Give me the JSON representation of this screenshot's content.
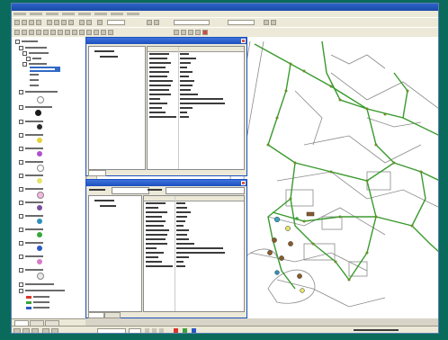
{
  "app": {
    "title": "",
    "menus": [
      "",
      "",
      "",
      "",
      "",
      "",
      "",
      "",
      ""
    ]
  },
  "dialogs": {
    "attributes": {
      "title": "",
      "tree_root": "",
      "tree_child": "",
      "tab_label": ""
    },
    "identify": {
      "title": "",
      "identify_from": "",
      "tree_root": "",
      "tree_child": "",
      "location": "",
      "tabs": [
        "",
        ""
      ]
    }
  },
  "toc": {
    "title": "",
    "tabs": [
      "",
      "",
      ""
    ]
  },
  "status": {
    "coords": ""
  },
  "colors": {
    "titlebar": "#1c4fbf",
    "desktop": "#0a6b5d",
    "map_lines": "#3a9a2e",
    "map_outlines": "#7a7a7a",
    "toc_dots": [
      "#1a1a1a",
      "#2a2a2a",
      "#e3d33a",
      "#b14fcf",
      "#ffffff",
      "#e6e36b",
      "#f7b7e0",
      "#7b4fa0",
      "#2f8fbd",
      "#36a83b",
      "#2b59c3",
      "#d67ac7",
      "#a0a0a0"
    ]
  }
}
